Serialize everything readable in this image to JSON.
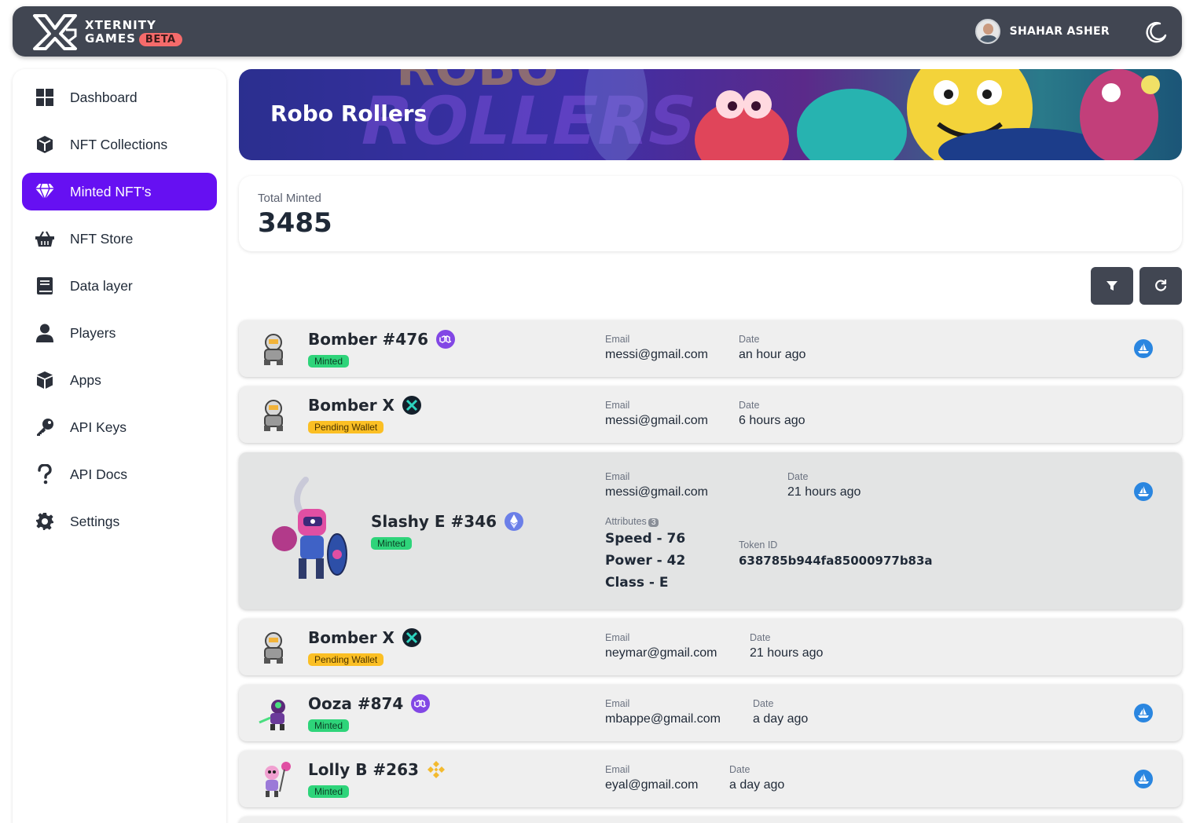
{
  "header": {
    "brand_line1": "XTERNITY",
    "brand_line2": "GAMES",
    "beta_label": "BETA",
    "user_name": "SHAHAR ASHER"
  },
  "sidebar": {
    "items": [
      {
        "label": "Dashboard",
        "icon": "grid-icon"
      },
      {
        "label": "NFT Collections",
        "icon": "cube-icon"
      },
      {
        "label": "Minted NFT's",
        "icon": "gem-icon",
        "active": true
      },
      {
        "label": "NFT Store",
        "icon": "basket-icon"
      },
      {
        "label": "Data layer",
        "icon": "book-icon"
      },
      {
        "label": "Players",
        "icon": "user-icon"
      },
      {
        "label": "Apps",
        "icon": "box-icon"
      },
      {
        "label": "API Keys",
        "icon": "key-icon"
      },
      {
        "label": "API Docs",
        "icon": "question-icon"
      },
      {
        "label": "Settings",
        "icon": "gear-icon"
      }
    ]
  },
  "banner": {
    "title": "Robo Rollers"
  },
  "summary": {
    "label": "Total Minted",
    "value": "3485"
  },
  "labels": {
    "email": "Email",
    "date": "Date",
    "attributes": "Attributes",
    "token_id": "Token ID"
  },
  "rows": [
    {
      "name": "Bomber #476",
      "chain": "polygon",
      "status": "Minted",
      "email": "messi@gmail.com",
      "date": "an hour ago",
      "download": true
    },
    {
      "name": "Bomber X",
      "chain": "immutable-x",
      "status": "Pending Wallet",
      "email": "messi@gmail.com",
      "date": "6 hours ago",
      "download": false
    },
    {
      "name": "Slashy E #346",
      "chain": "ethereum",
      "status": "Minted",
      "email": "messi@gmail.com",
      "date": "21 hours ago",
      "download": true,
      "attributes_count": "3",
      "attributes": [
        "Speed - 76",
        "Power - 42",
        "Class - E"
      ],
      "token_id": "638785b944fa85000977b83a"
    },
    {
      "name": "Bomber X",
      "chain": "immutable-x",
      "status": "Pending Wallet",
      "email": "neymar@gmail.com",
      "date": "21 hours ago",
      "download": false
    },
    {
      "name": "Ooza #874",
      "chain": "polygon",
      "status": "Minted",
      "email": "mbappe@gmail.com",
      "date": "a day ago",
      "download": true
    },
    {
      "name": "Lolly B #263",
      "chain": "binance",
      "status": "Minted",
      "email": "eyal@gmail.com",
      "date": "a day ago",
      "download": true
    }
  ],
  "colors": {
    "accent": "#6610f2",
    "topbar": "#414652",
    "minted": "#2ed47a",
    "pending": "#fbbf24",
    "download": "#2a86e0"
  }
}
